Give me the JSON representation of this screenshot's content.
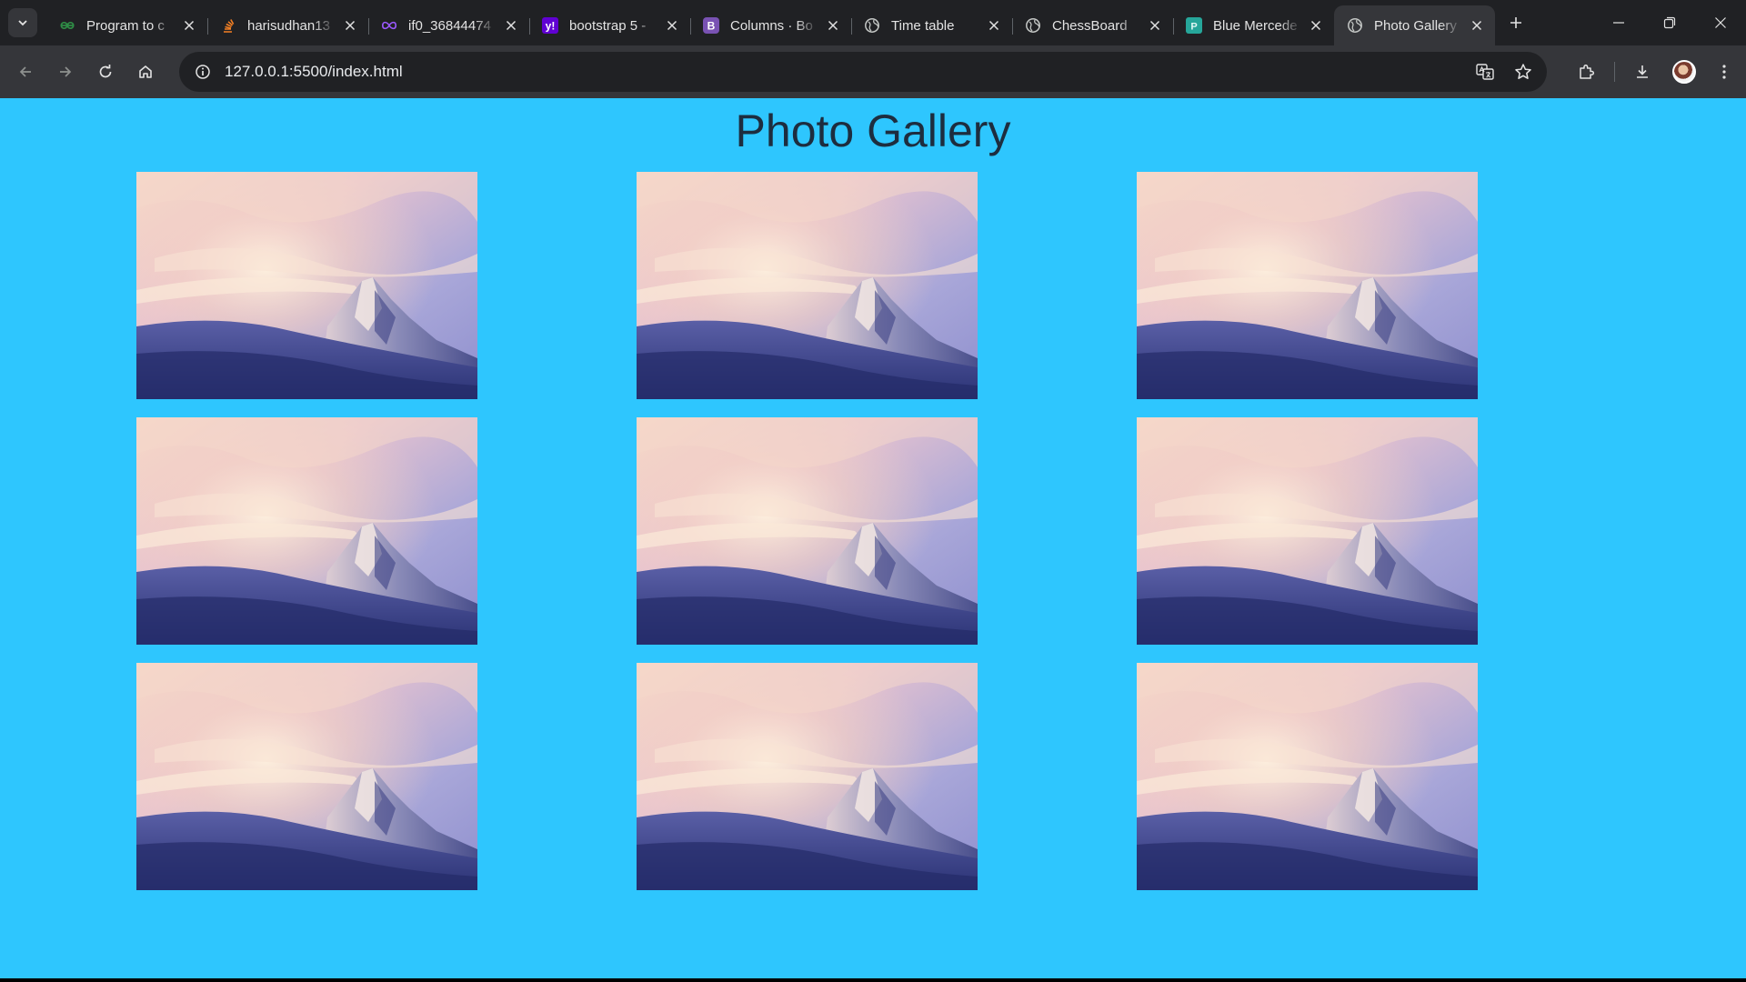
{
  "browser": {
    "tabs": [
      {
        "title": "Program to c",
        "favicon": "gfg-icon",
        "color": "#2f8d46"
      },
      {
        "title": "harisudhan13",
        "favicon": "stackoverflow-icon",
        "color": "#f48024"
      },
      {
        "title": "if0_36844474",
        "favicon": "infinity-icon",
        "color": "#9b59ff"
      },
      {
        "title": "bootstrap 5 -",
        "favicon": "yahoo-icon",
        "color": "#6001d2"
      },
      {
        "title": "Columns · Bo",
        "favicon": "bootstrap-icon",
        "color": "#7952b3"
      },
      {
        "title": "Time table",
        "favicon": "globe-icon",
        "color": "#c4c7c5"
      },
      {
        "title": "ChessBoard",
        "favicon": "globe-icon",
        "color": "#c4c7c5"
      },
      {
        "title": "Blue Mercede",
        "favicon": "p-icon",
        "color": "#26a69a"
      },
      {
        "title": "Photo Gallery",
        "favicon": "globe-icon",
        "color": "#c4c7c5",
        "active": true
      }
    ],
    "url": "127.0.0.1:5500/index.html"
  },
  "page": {
    "title": "Photo Gallery",
    "background": "#2ec6fe",
    "photos": [
      {
        "alt": "mountain-photo"
      },
      {
        "alt": "mountain-photo"
      },
      {
        "alt": "mountain-photo"
      },
      {
        "alt": "mountain-photo"
      },
      {
        "alt": "mountain-photo"
      },
      {
        "alt": "mountain-photo"
      },
      {
        "alt": "mountain-photo"
      },
      {
        "alt": "mountain-photo"
      },
      {
        "alt": "mountain-photo"
      }
    ]
  }
}
